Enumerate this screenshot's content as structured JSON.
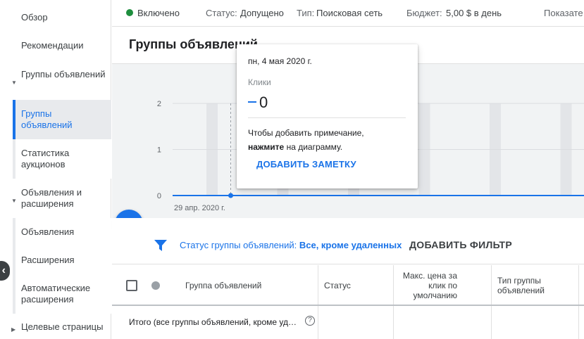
{
  "sidebar": {
    "items": [
      {
        "label": "Обзор"
      },
      {
        "label": "Рекомендации"
      },
      {
        "label": "Группы объявлений",
        "expanded": true
      },
      {
        "label": "Группы объявлений",
        "active": true
      },
      {
        "label": "Статистика аукционов"
      },
      {
        "label": "Объявления и расширения",
        "expanded": true
      },
      {
        "label": "Объявления"
      },
      {
        "label": "Расширения"
      },
      {
        "label": "Автоматические расширения"
      },
      {
        "label": "Целевые страницы",
        "expanded": false
      }
    ],
    "collapse_glyph": "‹"
  },
  "topbar": {
    "state": "Включено",
    "status_label": "Статус:",
    "status_value": "Допущено",
    "type_label": "Тип:",
    "type_value": "Поисковая сеть",
    "budget_label": "Бюджет:",
    "budget_value": "5,00 $ в день",
    "more_label": "Показате"
  },
  "page": {
    "title": "Группы объявлений"
  },
  "chart_data": {
    "type": "line",
    "y_ticks": [
      "0",
      "1",
      "2"
    ],
    "x_tick_label": "29 апр. 2020 г.",
    "ylim": [
      0,
      2
    ],
    "series": [
      {
        "name": "Клики",
        "color": "#1a73e8",
        "values": [
          0,
          0,
          0,
          0,
          0,
          0,
          0,
          0,
          0,
          0,
          0,
          0,
          0,
          0,
          0,
          0,
          0,
          0,
          0,
          0,
          0,
          0,
          0,
          0
        ]
      }
    ],
    "highlight_index": 1
  },
  "tooltip": {
    "date": "пн, 4 мая 2020 г.",
    "metric": "Клики",
    "value": "0",
    "note_prefix": "Чтобы добавить примечание,",
    "note_bold": "нажмите",
    "note_suffix": "на диаграмму.",
    "add_note_button": "ДОБАВИТЬ ЗАМЕТКУ"
  },
  "fab": {
    "glyph": "+"
  },
  "filter": {
    "label": "Статус группы объявлений:",
    "value": "Все, кроме удаленных",
    "add_filter": "ДОБАВИТЬ ФИЛЬТР"
  },
  "table": {
    "headers": {
      "name": "Группа объявлений",
      "status": "Статус",
      "max_cpc": "Макс. цена за клик по умолчанию",
      "type": "Тип группы объявлений"
    },
    "total_row": "Итого (все группы объявлений, кроме уд…",
    "help_glyph": "?"
  },
  "colors": {
    "accent": "#1a73e8",
    "enabled": "#1e8e3e",
    "chart_bg": "#f1f3f4"
  }
}
